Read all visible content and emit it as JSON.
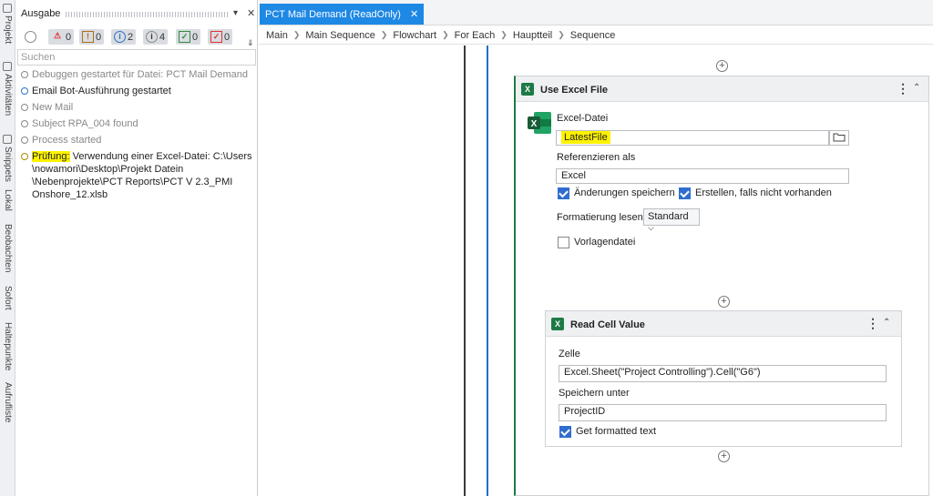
{
  "sidebar_tabs": [
    "Projekt",
    "Aktivitäten",
    "Snippets",
    "Lokal",
    "Beobachten",
    "Sofort",
    "Haltepunkte",
    "Aufrufliste"
  ],
  "output": {
    "title": "Ausgabe",
    "filters": [
      {
        "icon": "clock-icon",
        "count": ""
      },
      {
        "icon": "error-icon",
        "count": "0"
      },
      {
        "icon": "warning-icon",
        "count": "0"
      },
      {
        "icon": "info-icon",
        "count": "2"
      },
      {
        "icon": "trace-icon",
        "count": "4"
      },
      {
        "icon": "verbose-icon",
        "count": "0"
      },
      {
        "icon": "critical-icon",
        "count": "0"
      }
    ],
    "search_placeholder": "Suchen",
    "logs": [
      {
        "type": "dim",
        "text": "Debuggen gestartet für Datei: PCT Mail Demand"
      },
      {
        "type": "info",
        "text": "Email Bot-Ausführung gestartet"
      },
      {
        "type": "dim",
        "text": "New Mail"
      },
      {
        "type": "dim",
        "text": "Subject RPA_004 found"
      },
      {
        "type": "dim",
        "text": "Process started"
      }
    ],
    "warning_prefix": "Prüfung:",
    "warning_rest": " Verwendung einer Excel-Datei: C:\\Users \\nowamori\\Desktop\\Projekt Datein \\Nebenprojekte\\PCT Reports\\PCT V 2.3_PMI Onshore_12.xlsb"
  },
  "designer": {
    "tab_label": "PCT Mail Demand (ReadOnly)",
    "breadcrumbs": [
      "Main",
      "Main Sequence",
      "Flowchart",
      "For Each",
      "Hauptteil",
      "Sequence"
    ]
  },
  "use_excel": {
    "title": "Use Excel File",
    "file_label": "Excel-Datei",
    "file_value": "LatestFile",
    "ref_label": "Referenzieren als",
    "ref_value": "Excel",
    "save_changes": "Änderungen speichern",
    "create_if_missing": "Erstellen, falls nicht vorhanden",
    "format_label": "Formatierung lesen",
    "format_value": "Standard",
    "template_label": "Vorlagendatei"
  },
  "read_cell": {
    "title": "Read Cell Value",
    "cell_label": "Zelle",
    "cell_value": "Excel.Sheet(\"Project Controlling\").Cell(\"G6\")",
    "save_label": "Speichern unter",
    "save_value": "ProjectID",
    "formatted_label": "Get formatted text"
  },
  "colors": {
    "accent": "#1e88e5",
    "excel": "#1d7a45",
    "highlight": "#fff200"
  }
}
